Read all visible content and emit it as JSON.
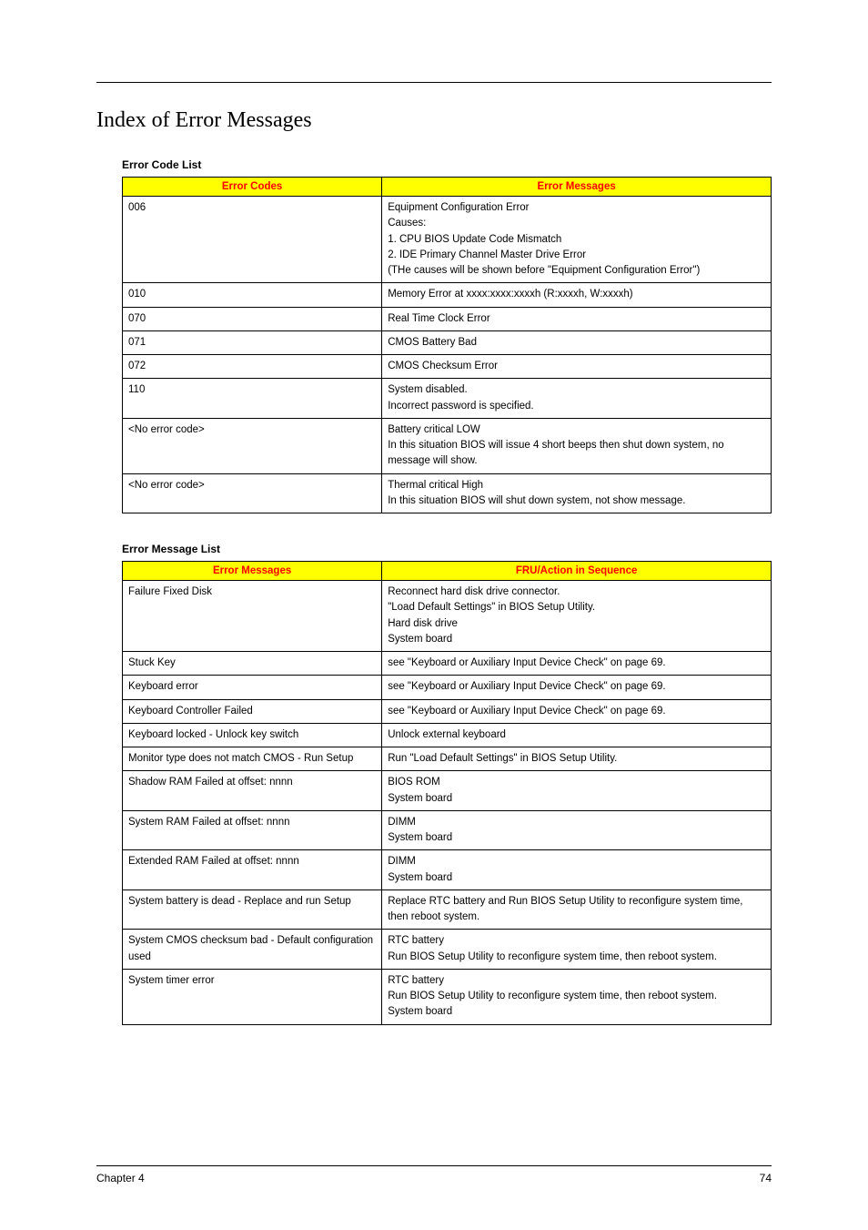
{
  "title": "Index of Error Messages",
  "table1": {
    "label": "Error Code List",
    "headers": [
      "Error Codes",
      "Error Messages"
    ],
    "rows": [
      {
        "code": "006",
        "msg": [
          "Equipment Configuration Error",
          "Causes:",
          "1. CPU BIOS Update Code Mismatch",
          "2. IDE Primary Channel Master Drive Error",
          "(THe causes will be shown before \"Equipment Configuration Error\")"
        ]
      },
      {
        "code": "010",
        "msg": [
          "Memory Error at xxxx:xxxx:xxxxh (R:xxxxh, W:xxxxh)"
        ]
      },
      {
        "code": "070",
        "msg": [
          "Real Time Clock Error"
        ]
      },
      {
        "code": "071",
        "msg": [
          "CMOS Battery Bad"
        ]
      },
      {
        "code": "072",
        "msg": [
          "CMOS Checksum Error"
        ]
      },
      {
        "code": "110",
        "msg": [
          "System disabled.",
          "Incorrect password is specified."
        ]
      },
      {
        "code": "<No error code>",
        "msg": [
          "Battery critical LOW",
          "In this situation BIOS will issue 4 short beeps then shut down system, no message will show."
        ]
      },
      {
        "code": "<No error code>",
        "msg": [
          "Thermal critical High",
          "In this situation BIOS will shut down system, not show message."
        ]
      }
    ]
  },
  "table2": {
    "label": "Error Message List",
    "headers": [
      "Error Messages",
      "FRU/Action in Sequence"
    ],
    "rows": [
      {
        "code": "Failure Fixed Disk",
        "msg": [
          "Reconnect hard disk drive connector.",
          "\"Load Default Settings\" in BIOS Setup Utility.",
          "Hard disk drive",
          "System board"
        ]
      },
      {
        "code": "Stuck Key",
        "msg": [
          "see \"Keyboard or Auxiliary Input Device Check\" on page 69."
        ]
      },
      {
        "code": "Keyboard error",
        "msg": [
          "see \"Keyboard or Auxiliary Input Device Check\" on page 69."
        ]
      },
      {
        "code": "Keyboard Controller Failed",
        "msg": [
          "see \"Keyboard or Auxiliary Input Device Check\" on page 69."
        ]
      },
      {
        "code": "Keyboard locked - Unlock key switch",
        "msg": [
          "Unlock external keyboard"
        ]
      },
      {
        "code": "Monitor type does not match CMOS - Run Setup",
        "msg": [
          "Run \"Load Default Settings\" in BIOS Setup Utility."
        ]
      },
      {
        "code": "Shadow RAM Failed at offset: nnnn",
        "msg": [
          "BIOS ROM",
          "System board"
        ]
      },
      {
        "code": "System RAM Failed at offset: nnnn",
        "msg": [
          "DIMM",
          "System board"
        ]
      },
      {
        "code": "Extended RAM Failed at offset: nnnn",
        "msg": [
          "DIMM",
          "System board"
        ]
      },
      {
        "code": "System battery is dead - Replace and run Setup",
        "msg": [
          "Replace RTC battery and Run BIOS Setup Utility to reconfigure system time, then reboot system."
        ]
      },
      {
        "code": "System CMOS checksum bad - Default configuration used",
        "msg": [
          "RTC battery",
          "Run BIOS Setup Utility to reconfigure system time, then reboot system."
        ]
      },
      {
        "code": "System timer error",
        "msg": [
          "RTC battery",
          "Run BIOS Setup Utility to reconfigure system time, then reboot system.",
          "System board"
        ]
      }
    ]
  },
  "footer": {
    "left": "Chapter 4",
    "right": "74"
  }
}
